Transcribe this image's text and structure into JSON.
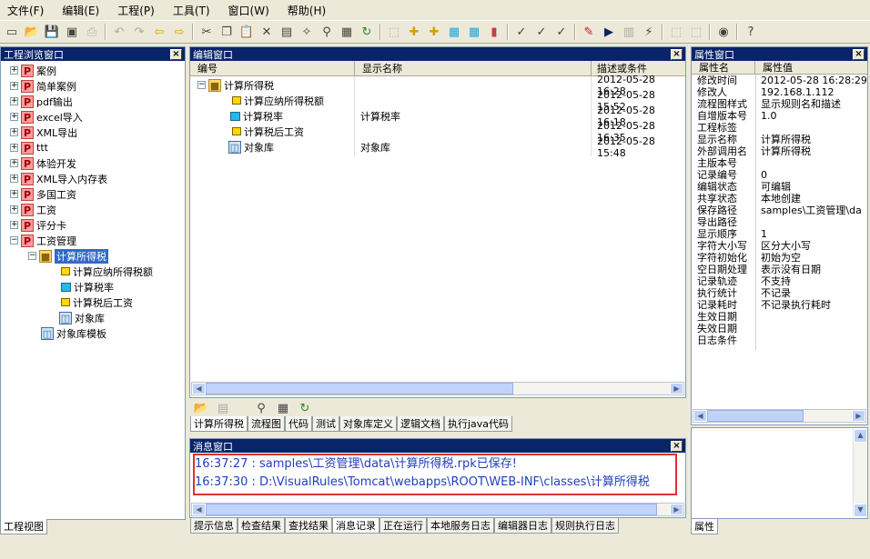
{
  "menu": {
    "items": [
      "文件(F)",
      "编辑(E)",
      "工程(P)",
      "工具(T)",
      "窗口(W)",
      "帮助(H)"
    ]
  },
  "project_pane": {
    "title": "工程浏览窗口",
    "tree": [
      {
        "label": "案例"
      },
      {
        "label": "简单案例"
      },
      {
        "label": "pdf输出"
      },
      {
        "label": "excel导入"
      },
      {
        "label": "XML导出"
      },
      {
        "label": "ttt"
      },
      {
        "label": "体验开发"
      },
      {
        "label": "XML导入内存表"
      },
      {
        "label": "多国工资"
      },
      {
        "label": "工资"
      },
      {
        "label": "评分卡"
      },
      {
        "label": "工资管理"
      },
      {
        "label": "计算所得税"
      },
      {
        "label": "计算应纳所得税额"
      },
      {
        "label": "计算税率"
      },
      {
        "label": "计算税后工资"
      },
      {
        "label": "对象库"
      },
      {
        "label": "对象库模板"
      }
    ],
    "tab": "工程视图"
  },
  "editor_pane": {
    "title": "编辑窗口",
    "columns": [
      "编号",
      "显示名称",
      "描述或条件"
    ],
    "rows": [
      {
        "id": "计算所得税",
        "name": "",
        "desc": "2012-05-28 16:28"
      },
      {
        "id": "计算应纳所得税额",
        "name": "",
        "desc": "2012-05-28 15:52"
      },
      {
        "id": "计算税率",
        "name": "计算税率",
        "desc": "2012-05-28 16:18"
      },
      {
        "id": "计算税后工资",
        "name": "",
        "desc": "2012-05-28 16:35"
      },
      {
        "id": "对象库",
        "name": "对象库",
        "desc": "2012-05-28 15:48"
      }
    ],
    "tabs": [
      "计算所得税",
      "流程图",
      "代码",
      "测试",
      "对象库定义",
      "逻辑文档",
      "执行java代码"
    ]
  },
  "message_pane": {
    "title": "消息窗口",
    "lines": [
      "16:37:27 : samples\\工资管理\\data\\计算所得税.rpk已保存!",
      "16:37:30 : D:\\VisualRules\\Tomcat\\webapps\\ROOT\\WEB-INF\\classes\\计算所得税"
    ],
    "tabs": [
      "提示信息",
      "检查结果",
      "查找结果",
      "消息记录",
      "正在运行",
      "本地服务日志",
      "编辑器日志",
      "规则执行日志"
    ]
  },
  "property_pane": {
    "title": "属性窗口",
    "columns": [
      "属性名",
      "属性值"
    ],
    "rows": [
      {
        "k": "修改时间",
        "v": "2012-05-28 16:28:29"
      },
      {
        "k": "修改人",
        "v": "192.168.1.112"
      },
      {
        "k": "流程图样式",
        "v": "显示规则名和描述"
      },
      {
        "k": "自增版本号",
        "v": "1.0"
      },
      {
        "k": "工程标签",
        "v": ""
      },
      {
        "k": "显示名称",
        "v": "计算所得税"
      },
      {
        "k": "外部调用名",
        "v": "计算所得税"
      },
      {
        "k": "主版本号",
        "v": ""
      },
      {
        "k": "记录编号",
        "v": "0"
      },
      {
        "k": "编辑状态",
        "v": "可编辑"
      },
      {
        "k": "共享状态",
        "v": "本地创建"
      },
      {
        "k": "保存路径",
        "v": "samples\\工资管理\\da"
      },
      {
        "k": "导出路径",
        "v": ""
      },
      {
        "k": "显示顺序",
        "v": "1"
      },
      {
        "k": "字符大小写",
        "v": "区分大小写"
      },
      {
        "k": "字符初始化",
        "v": "初始为空"
      },
      {
        "k": "空日期处理",
        "v": "表示没有日期"
      },
      {
        "k": "记录轨迹",
        "v": "不支持"
      },
      {
        "k": "执行统计",
        "v": "不记录"
      },
      {
        "k": "记录耗时",
        "v": "不记录执行耗时"
      },
      {
        "k": "生效日期",
        "v": ""
      },
      {
        "k": "失效日期",
        "v": ""
      },
      {
        "k": "日志条件",
        "v": ""
      }
    ],
    "tab": "属性"
  },
  "colors": {
    "title_bg": "#0a246a",
    "message_text": "#1f3fbf",
    "highlight_border": "#e03030"
  }
}
